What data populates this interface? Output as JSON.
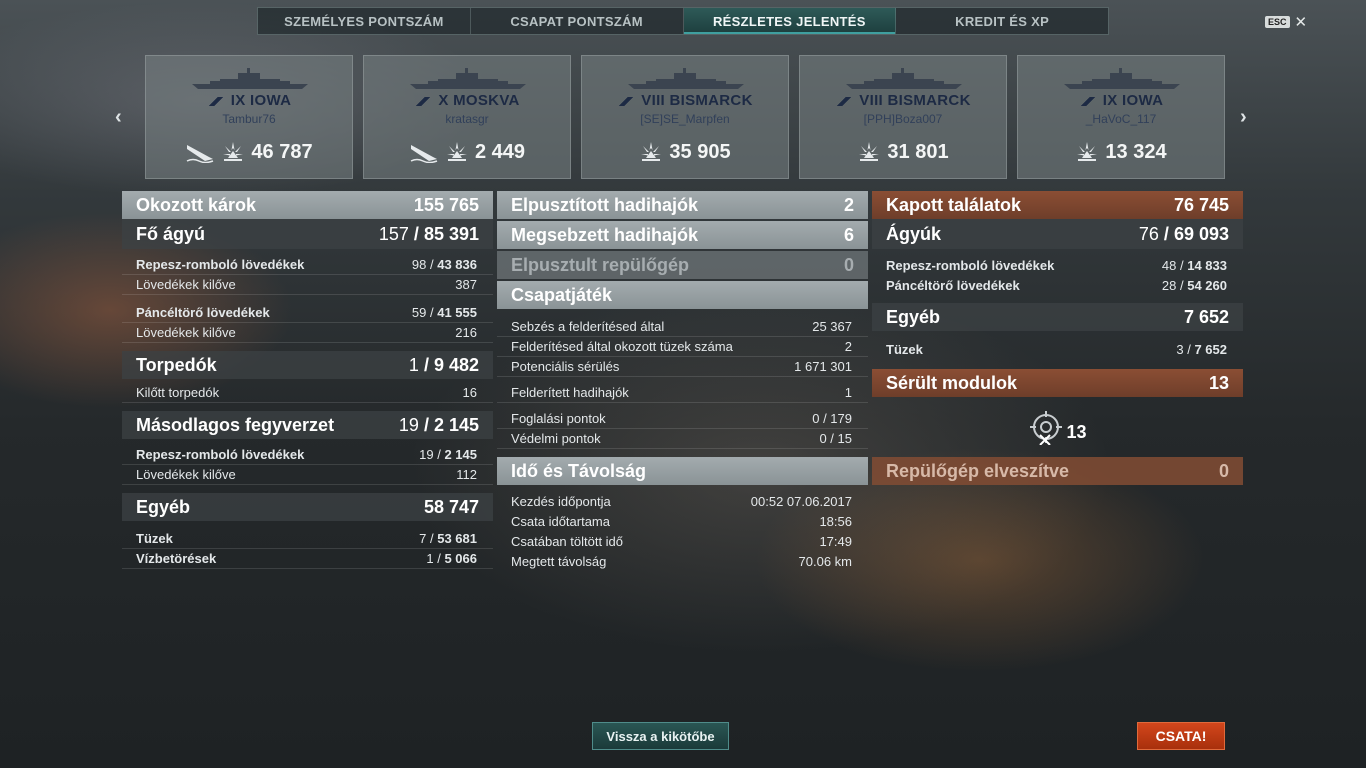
{
  "tabs": [
    {
      "label": "SZEMÉLYES PONTSZÁM",
      "active": false
    },
    {
      "label": "CSAPAT PONTSZÁM",
      "active": false
    },
    {
      "label": "RÉSZLETES JELENTÉS",
      "active": true
    },
    {
      "label": "KREDIT ÉS XP",
      "active": false
    }
  ],
  "esc_label": "ESC",
  "close_icon": "close-icon",
  "cards": [
    {
      "ship": "IX IOWA",
      "player": "Tambur76",
      "value": "46 787",
      "sunk_icon": true
    },
    {
      "ship": "X MOSKVA",
      "player": "kratasgr",
      "value": "2 449",
      "sunk_icon": true
    },
    {
      "ship": "VIII BISMARCK",
      "player": "[SE]SE_Marpfen",
      "value": "35 905",
      "sunk_icon": false
    },
    {
      "ship": "VIII BISMARCK",
      "player": "[PPH]Boza007",
      "value": "31 801",
      "sunk_icon": false
    },
    {
      "ship": "IX IOWA",
      "player": "_HaVoC_117",
      "value": "13 324",
      "sunk_icon": false
    }
  ],
  "left": {
    "damage_header": {
      "label": "Okozott károk",
      "value": "155 765"
    },
    "main": {
      "label": "Fő ágyú",
      "count": "157",
      "value": "85 391"
    },
    "he": {
      "label": "Repesz-romboló lövedékek",
      "count": "98",
      "value": "43 836"
    },
    "he_fired": {
      "label": "Lövedékek kilőve",
      "value": "387"
    },
    "ap": {
      "label": "Páncéltörő lövedékek",
      "count": "59",
      "value": "41 555"
    },
    "ap_fired": {
      "label": "Lövedékek kilőve",
      "value": "216"
    },
    "torp": {
      "label": "Torpedók",
      "count": "1",
      "value": "9 482"
    },
    "torp_fired": {
      "label": "Kilőtt torpedók",
      "value": "16"
    },
    "secondary": {
      "label": "Másodlagos fegyverzet",
      "count": "19",
      "value": "2 145"
    },
    "sec_he": {
      "label": "Repesz-romboló lövedékek",
      "count": "19",
      "value": "2 145"
    },
    "sec_fired": {
      "label": "Lövedékek kilőve",
      "value": "112"
    },
    "other": {
      "label": "Egyéb",
      "value": "58 747"
    },
    "fires": {
      "label": "Tüzek",
      "count": "7",
      "value": "53 681"
    },
    "flood": {
      "label": "Vízbetörések",
      "count": "1",
      "value": "5 066"
    }
  },
  "middle": {
    "destroyed": {
      "label": "Elpusztított hadihajók",
      "value": "2"
    },
    "damaged": {
      "label": "Megsebzett hadihajók",
      "value": "6"
    },
    "planes": {
      "label": "Elpusztult repülőgép",
      "value": "0"
    },
    "team_header": "Csapatjáték",
    "spot_damage": {
      "label": "Sebzés a felderítésed által",
      "value": "25 367"
    },
    "spot_fires": {
      "label": "Felderítésed által okozott tüzek száma",
      "value": "2"
    },
    "potential": {
      "label": "Potenciális sérülés",
      "value": "1 671 301"
    },
    "spotted": {
      "label": "Felderített hadihajók",
      "value": "1"
    },
    "capture": {
      "label": "Foglalási pontok",
      "value": "0 / 179"
    },
    "defense": {
      "label": "Védelmi pontok",
      "value": "0 / 15"
    },
    "time_header": "Idő és Távolság",
    "start": {
      "label": "Kezdés időpontja",
      "value": "00:52  07.06.2017"
    },
    "duration": {
      "label": "Csata időtartama",
      "value": "18:56"
    },
    "in_battle": {
      "label": "Csatában töltött idő",
      "value": "17:49"
    },
    "distance": {
      "label": "Megtett távolság",
      "value": "70.06 km"
    }
  },
  "right": {
    "received": {
      "label": "Kapott találatok",
      "value": "76 745"
    },
    "guns": {
      "label": "Ágyúk",
      "count": "76",
      "value": "69 093"
    },
    "he": {
      "label": "Repesz-romboló lövedékek",
      "count": "48",
      "value": "14 833"
    },
    "ap": {
      "label": "Páncéltörő lövedékek",
      "count": "28",
      "value": "54 260"
    },
    "other": {
      "label": "Egyéb",
      "value": "7 652"
    },
    "fires": {
      "label": "Tüzek",
      "count": "3",
      "value": "7 652"
    },
    "modules": {
      "label": "Sérült modulok",
      "value": "13"
    },
    "modules_icon_value": "13",
    "planes_lost": {
      "label": "Repülőgép elveszítve",
      "value": "0"
    }
  },
  "buttons": {
    "port": "Vissza a kikötőbe",
    "battle": "CSATA!"
  },
  "colors": {
    "accent_teal": "#2a5654",
    "battle_orange": "#d3461c",
    "panel_orange": "#8b4e34"
  }
}
